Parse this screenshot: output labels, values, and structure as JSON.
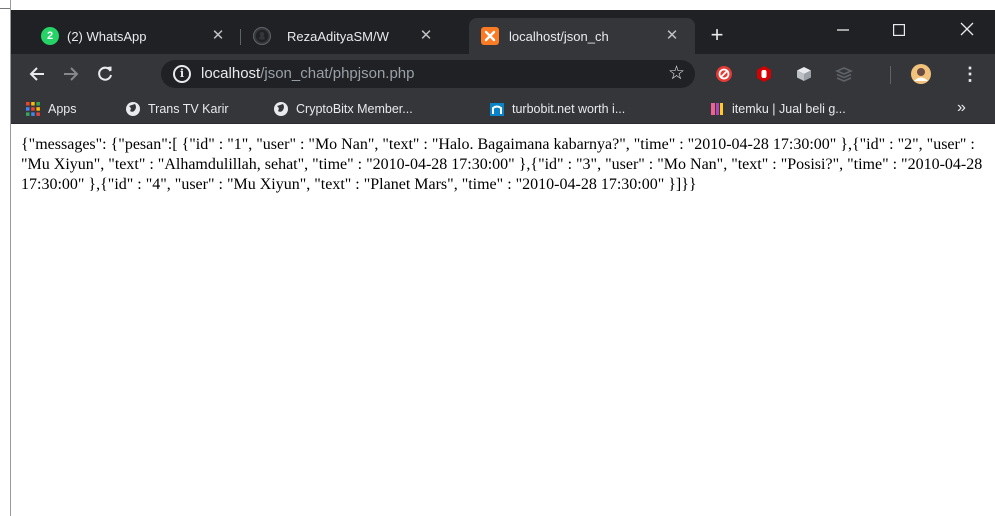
{
  "browser": {
    "tabs": [
      {
        "title": "(2) WhatsApp",
        "active": false,
        "icon": "whatsapp-icon",
        "badge": "2"
      },
      {
        "title": "RezaAdityaSM/W",
        "active": false,
        "icon": "github-icon"
      },
      {
        "title": "localhost/json_ch",
        "active": true,
        "icon": "xampp-icon"
      }
    ],
    "new_tab_icon": "plus-icon",
    "window_controls": [
      "minimize-icon",
      "maximize-icon",
      "close-icon"
    ]
  },
  "toolbar": {
    "url_host": "localhost",
    "url_path": "/json_chat/phpjson.php",
    "extensions": [
      "red-blocker-icon",
      "red-hand-icon",
      "cube-icon",
      "stack-icon",
      "profile-avatar"
    ]
  },
  "bookmarks": [
    {
      "label": "Apps",
      "icon": "apps-grid-icon"
    },
    {
      "label": "Trans TV Karir",
      "icon": "globe-icon"
    },
    {
      "label": "CryptoBitx Member...",
      "icon": "globe-icon"
    },
    {
      "label": "turbobit.net worth i...",
      "icon": "n-logo-icon"
    },
    {
      "label": "itemku | Jual beli g...",
      "icon": "itemku-icon"
    }
  ],
  "bookmarks_overflow": "»",
  "page": {
    "json_text": "{\"messages\": {\"pesan\":[ {\"id\" : \"1\", \"user\" : \"Mo Nan\", \"text\" : \"Halo. Bagaimana kabarnya?\", \"time\" : \"2010-04-28 17:30:00\" },{\"id\" : \"2\", \"user\" : \"Mu Xiyun\", \"text\" : \"Alhamdulillah, sehat\", \"time\" : \"2010-04-28 17:30:00\" },{\"id\" : \"3\", \"user\" : \"Mo Nan\", \"text\" : \"Posisi?\", \"time\" : \"2010-04-28 17:30:00\" },{\"id\" : \"4\", \"user\" : \"Mu Xiyun\", \"text\" : \"Planet Mars\", \"time\" : \"2010-04-28 17:30:00\" }]}}"
  },
  "colors": {
    "tabstrip_bg": "#202124",
    "toolbar_bg": "#35363a",
    "omnibox_bg": "#202124",
    "whatsapp": "#25d366",
    "xampp": "#fb7a24"
  }
}
